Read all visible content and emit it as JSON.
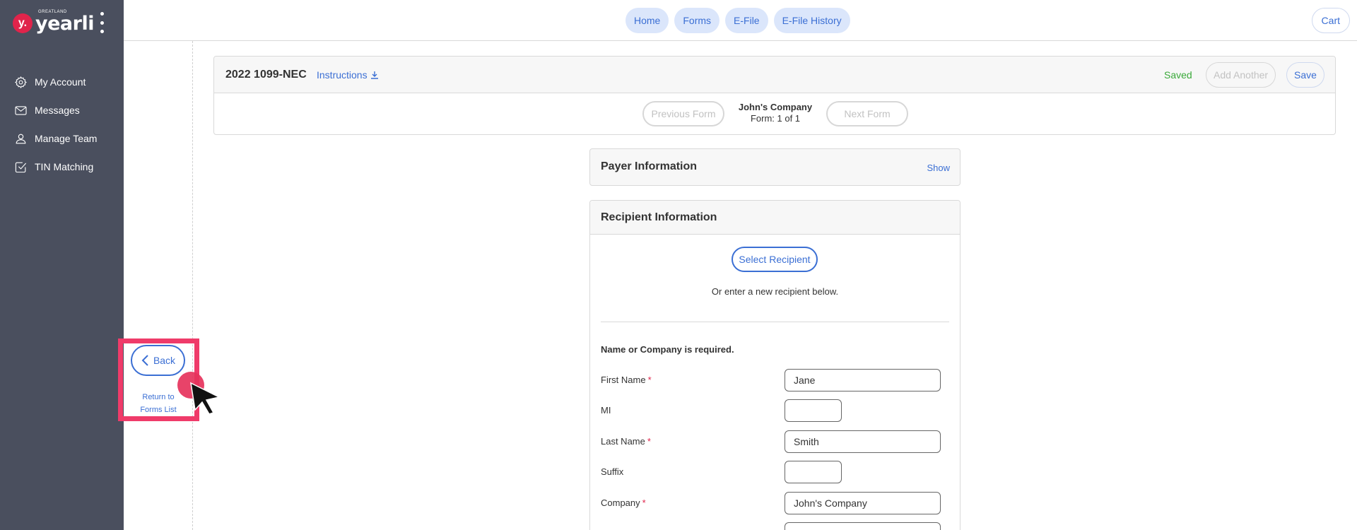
{
  "brand": {
    "badge_letter": "y.",
    "name": "yearli",
    "small_text": "GREATLAND"
  },
  "sidebar": {
    "items": [
      {
        "label": "My Account",
        "icon": "gear-icon"
      },
      {
        "label": "Messages",
        "icon": "envelope-icon"
      },
      {
        "label": "Manage Team",
        "icon": "user-icon"
      },
      {
        "label": "TIN Matching",
        "icon": "check-square-icon"
      }
    ]
  },
  "topnav": {
    "tabs": [
      "Home",
      "Forms",
      "E-File",
      "E-File History"
    ],
    "cart_label": "Cart"
  },
  "back": {
    "label": "Back",
    "return_line1": "Return to",
    "return_line2": "Forms List"
  },
  "form_header": {
    "title": "2022 1099-NEC",
    "instructions_label": "Instructions",
    "status": "Saved",
    "add_another_label": "Add Another",
    "save_label": "Save",
    "prev_label": "Previous Form",
    "next_label": "Next Form",
    "company": "John's Company",
    "form_counter": "Form: 1 of 1"
  },
  "payer": {
    "title": "Payer Information",
    "toggle_label": "Show"
  },
  "recipient": {
    "title": "Recipient Information",
    "select_label": "Select Recipient",
    "or_text": "Or enter a new recipient below.",
    "required_note": "Name or Company is required.",
    "fields": {
      "first_name": {
        "label": "First Name",
        "value": "Jane",
        "required": true
      },
      "mi": {
        "label": "MI",
        "value": "",
        "required": false
      },
      "last_name": {
        "label": "Last Name",
        "value": "Smith",
        "required": true
      },
      "suffix": {
        "label": "Suffix",
        "value": "",
        "required": false
      },
      "company": {
        "label": "Company",
        "value": "John's Company",
        "required": true
      }
    },
    "required_marker": "*"
  },
  "colors": {
    "sidebar_bg": "#4a4f5e",
    "accent": "#3b6fd4",
    "pill_bg": "#dbe6fb",
    "saved_green": "#3aa93a",
    "brand_red": "#e0244b",
    "highlight_pink": "#ef3b6a"
  }
}
